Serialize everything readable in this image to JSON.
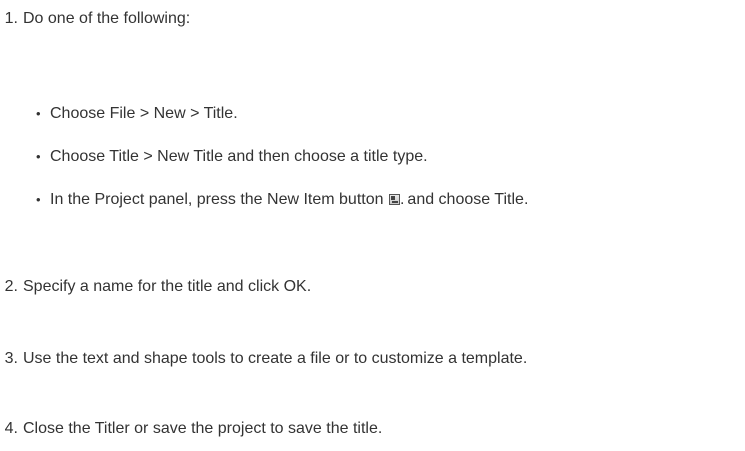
{
  "steps": [
    {
      "num": "1.",
      "text": "Do one of the following:"
    },
    {
      "num": "2.",
      "text": "Specify a name for the title and click OK."
    },
    {
      "num": "3.",
      "text": "Use the text and shape tools to create a file or to customize a template."
    },
    {
      "num": "4.",
      "text": "Close the Titler or save the project to save the title."
    }
  ],
  "options": [
    {
      "text": "Choose File > New > Title."
    },
    {
      "text": "Choose Title > New Title and then choose a title type."
    },
    {
      "text_before": "In the Project panel, press the New Item button",
      "text_after": " and choose Title.",
      "icon": "new-item-icon"
    }
  ],
  "bullet_char": "•"
}
